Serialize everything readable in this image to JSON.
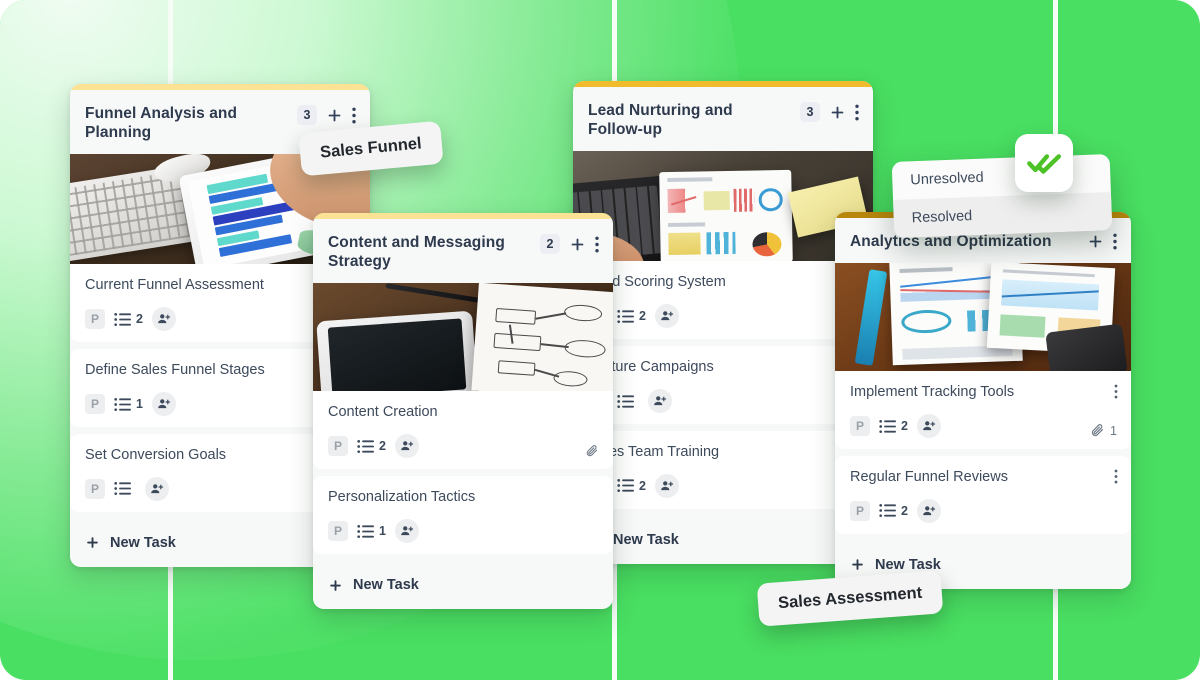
{
  "background": {
    "base_color": "#49df62",
    "glow_color": "#ffffff",
    "divider_color": "#f6fdf7"
  },
  "labels": {
    "sales_funnel": "Sales Funnel",
    "sales_assessment": "Sales Assessment"
  },
  "dropdown": {
    "options": [
      {
        "label": "Unresolved",
        "selected": false
      },
      {
        "label": "Resolved",
        "selected": true
      }
    ]
  },
  "check_badge": {
    "icon": "done-all-icon",
    "color": "#4cc227"
  },
  "common": {
    "new_task_label": "New Task",
    "priority_chip": "P",
    "plus_icon": "plus-icon",
    "kebab_icon": "more-vertical-icon",
    "list_icon": "checklist-icon",
    "person_add_icon": "person-add-icon",
    "attachment_icon": "paperclip-icon",
    "done_icon": "done-all-icon"
  },
  "columns": [
    {
      "id": "funnel-analysis-and-planning",
      "title": "Funnel Analysis and Planning",
      "count": "3",
      "accent_color": "#fce294",
      "hero": "desk-keyboard-tablet-chart",
      "tasks": [
        {
          "title": "Current Funnel Assessment",
          "priority": "P",
          "checklist": "2",
          "assignee": "person-add-icon",
          "status_icon": "done-all-icon",
          "attachments": ""
        },
        {
          "title": "Define Sales Funnel Stages",
          "priority": "P",
          "checklist": "1",
          "assignee": "person-add-icon",
          "status_icon": "",
          "attachments": ""
        },
        {
          "title": "Set Conversion Goals",
          "priority": "P",
          "checklist": "",
          "assignee": "person-add-icon",
          "status_icon": "",
          "attachments": ""
        }
      ]
    },
    {
      "id": "content-and-messaging-strategy",
      "title": "Content and Messaging Strategy",
      "count": "2",
      "accent_color": "#fce294",
      "hero": "tablet-handdrawn-diagram",
      "tasks": [
        {
          "title": "Content Creation",
          "priority": "P",
          "checklist": "2",
          "assignee": "person-add-icon",
          "status_icon": "",
          "attachments": ""
        },
        {
          "title": "Personalization Tactics",
          "priority": "P",
          "checklist": "1",
          "assignee": "person-add-icon",
          "status_icon": "",
          "attachments": ""
        }
      ]
    },
    {
      "id": "lead-nurturing-and-follow-up",
      "title": "Lead Nurturing and Follow-up",
      "count": "3",
      "accent_color": "#f0bc2e",
      "hero": "laptop-dashboard-sticky-note",
      "tasks": [
        {
          "title": "Lead Scoring System",
          "priority": "P",
          "checklist": "2",
          "assignee": "person-add-icon",
          "status_icon": "",
          "attachments": ""
        },
        {
          "title": "Nurture Campaigns",
          "priority": "P",
          "checklist": "",
          "assignee": "person-add-icon",
          "status_icon": "",
          "attachments": ""
        },
        {
          "title": "Sales Team Training",
          "priority": "P",
          "checklist": "2",
          "assignee": "person-add-icon",
          "status_icon": "",
          "attachments": ""
        }
      ]
    },
    {
      "id": "analytics-and-optimization",
      "title": "Analytics and Optimization",
      "count": "",
      "accent_color": "#b8860b",
      "hero": "printed-reports-on-desk",
      "tasks": [
        {
          "title": "Implement Tracking Tools",
          "priority": "P",
          "checklist": "2",
          "assignee": "person-add-icon",
          "status_icon": "",
          "attachments": "1"
        },
        {
          "title": "Regular Funnel Reviews",
          "priority": "P",
          "checklist": "2",
          "assignee": "person-add-icon",
          "status_icon": "",
          "attachments": ""
        }
      ]
    }
  ]
}
